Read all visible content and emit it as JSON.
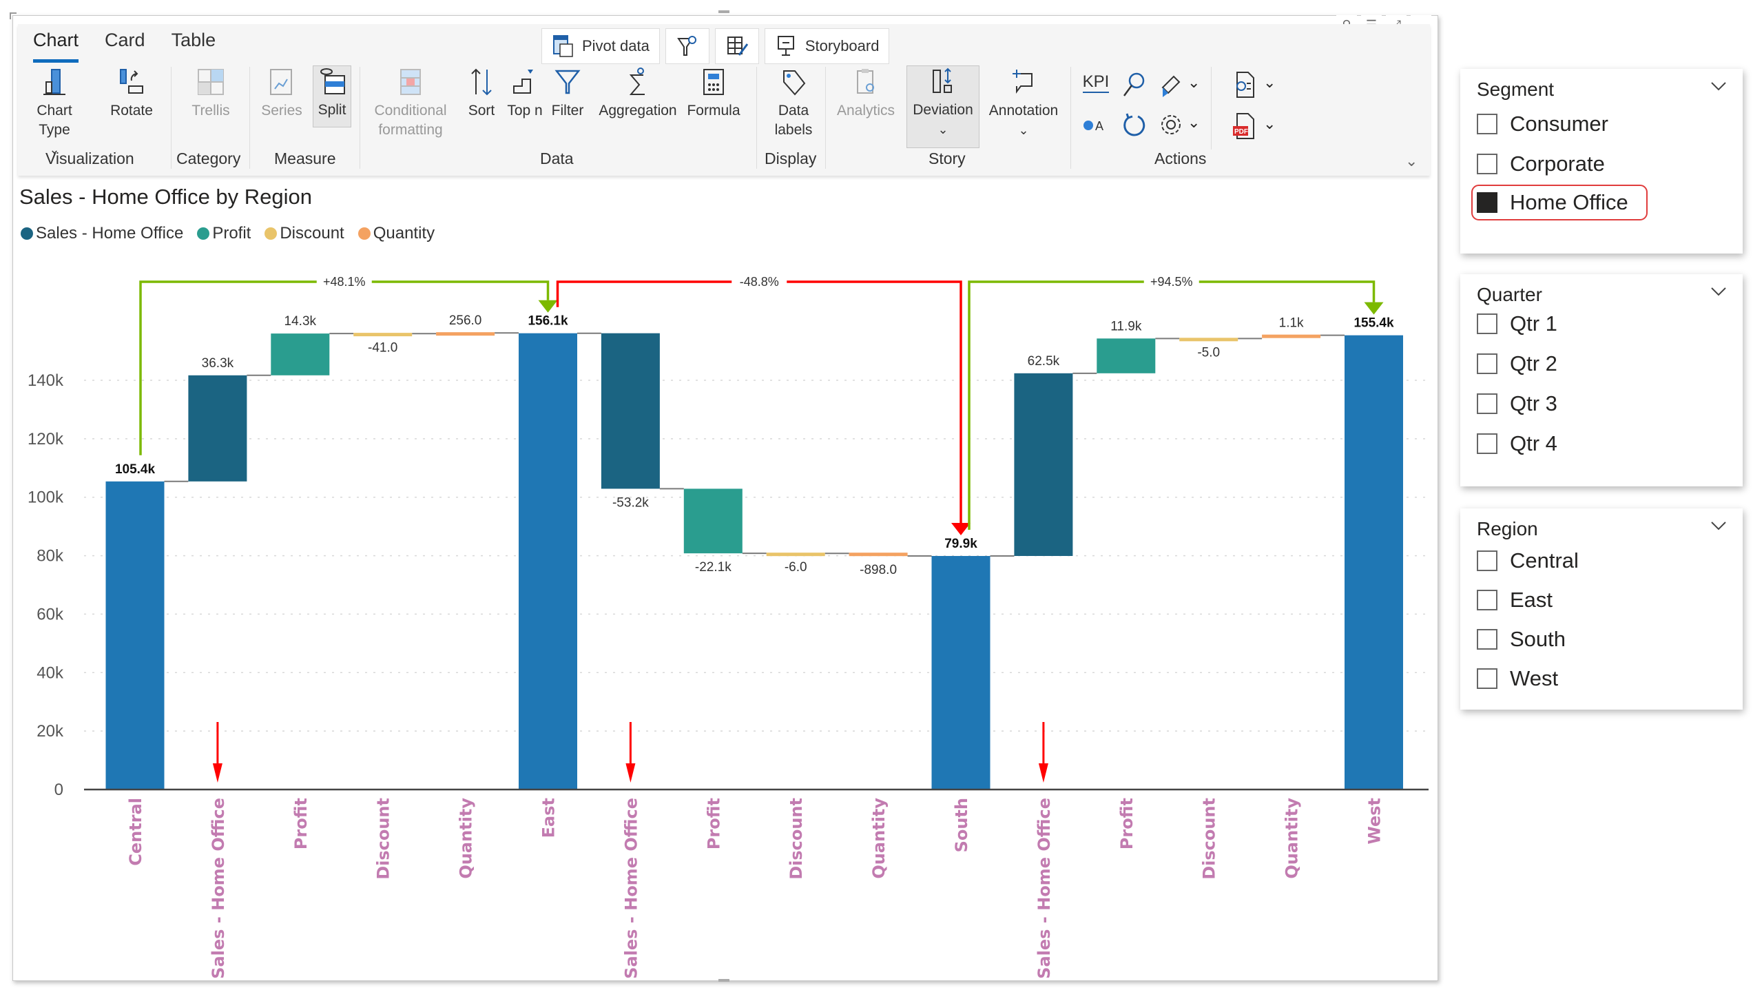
{
  "ribbon": {
    "tabs": [
      {
        "label": "Chart",
        "active": true
      },
      {
        "label": "Card",
        "active": false
      },
      {
        "label": "Table",
        "active": false
      }
    ],
    "top_buttons": {
      "pivot_data": "Pivot data",
      "storyboard": "Storyboard"
    },
    "items": {
      "chart_type": "Chart Type",
      "rotate": "Rotate",
      "trellis": "Trellis",
      "series": "Series",
      "split": "Split",
      "conditional_formatting_1": "Conditional",
      "conditional_formatting_2": "formatting",
      "sort": "Sort",
      "top_n": "Top n",
      "filter": "Filter",
      "aggregation": "Aggregation",
      "formula": "Formula",
      "data_labels_1": "Data",
      "data_labels_2": "labels",
      "analytics": "Analytics",
      "deviation": "Deviation",
      "annotation": "Annotation",
      "kpi": "KPI"
    },
    "groups": {
      "visualization": "Visualization",
      "category": "Category",
      "measure": "Measure",
      "data": "Data",
      "display": "Display",
      "story": "Story",
      "actions": "Actions"
    }
  },
  "chart_data": {
    "type": "waterfall",
    "title": "Sales - Home Office by Region",
    "legend": [
      {
        "name": "Sales - Home Office",
        "color": "#1b6482"
      },
      {
        "name": "Profit",
        "color": "#2a9d8f"
      },
      {
        "name": "Discount",
        "color": "#e9c46a"
      },
      {
        "name": "Quantity",
        "color": "#f4a261"
      }
    ],
    "total_color": "#1f77b4",
    "categories": [
      "Central",
      "Sales - Home Office",
      "Profit",
      "Discount",
      "Quantity",
      "East",
      "Sales - Home Office",
      "Profit",
      "Discount",
      "Quantity",
      "South",
      "Sales - Home Office",
      "Profit",
      "Discount",
      "Quantity",
      "West"
    ],
    "points": [
      {
        "kind": "total",
        "value": 105400,
        "label": "105.4k"
      },
      {
        "kind": "delta",
        "series": "Sales - Home Office",
        "value": 36300,
        "label": "36.3k"
      },
      {
        "kind": "delta",
        "series": "Profit",
        "value": 14300,
        "label": "14.3k"
      },
      {
        "kind": "delta",
        "series": "Discount",
        "value": -41,
        "label": "-41.0"
      },
      {
        "kind": "delta",
        "series": "Quantity",
        "value": 256,
        "label": "256.0"
      },
      {
        "kind": "total",
        "value": 156100,
        "label": "156.1k"
      },
      {
        "kind": "delta",
        "series": "Sales - Home Office",
        "value": -53200,
        "label": "-53.2k"
      },
      {
        "kind": "delta",
        "series": "Profit",
        "value": -22100,
        "label": "-22.1k"
      },
      {
        "kind": "delta",
        "series": "Discount",
        "value": -6,
        "label": "-6.0"
      },
      {
        "kind": "delta",
        "series": "Quantity",
        "value": -898,
        "label": "-898.0"
      },
      {
        "kind": "total",
        "value": 79900,
        "label": "79.9k"
      },
      {
        "kind": "delta",
        "series": "Sales - Home Office",
        "value": 62500,
        "label": "62.5k"
      },
      {
        "kind": "delta",
        "series": "Profit",
        "value": 11900,
        "label": "11.9k"
      },
      {
        "kind": "delta",
        "series": "Discount",
        "value": -5,
        "label": "-5.0"
      },
      {
        "kind": "delta",
        "series": "Quantity",
        "value": 1100,
        "label": "1.1k"
      },
      {
        "kind": "total",
        "value": 155400,
        "label": "155.4k"
      }
    ],
    "y_ticks": [
      0,
      20000,
      40000,
      60000,
      80000,
      100000,
      120000,
      140000
    ],
    "y_tick_labels": [
      "0",
      "20k",
      "40k",
      "60k",
      "80k",
      "100k",
      "120k",
      "140k"
    ],
    "ylim": [
      0,
      140000
    ],
    "grid": true,
    "legend_position": "top-left",
    "deviations": [
      {
        "from": 0,
        "to": 5,
        "label": "+48.1%",
        "color": "#7cb900"
      },
      {
        "from": 5,
        "to": 10,
        "label": "-48.8%",
        "color": "#ff0000"
      },
      {
        "from": 10,
        "to": 15,
        "label": "+94.5%",
        "color": "#7cb900"
      }
    ],
    "highlight_arrows_at": [
      1,
      6,
      11
    ]
  },
  "slicers": [
    {
      "title": "Segment",
      "items": [
        {
          "label": "Consumer",
          "checked": false
        },
        {
          "label": "Corporate",
          "checked": false
        },
        {
          "label": "Home Office",
          "checked": true
        }
      ]
    },
    {
      "title": "Quarter",
      "items": [
        {
          "label": "Qtr 1",
          "checked": false
        },
        {
          "label": "Qtr 2",
          "checked": false
        },
        {
          "label": "Qtr 3",
          "checked": false
        },
        {
          "label": "Qtr 4",
          "checked": false
        }
      ]
    },
    {
      "title": "Region",
      "items": [
        {
          "label": "Central",
          "checked": false
        },
        {
          "label": "East",
          "checked": false
        },
        {
          "label": "South",
          "checked": false
        },
        {
          "label": "West",
          "checked": false
        }
      ]
    }
  ]
}
